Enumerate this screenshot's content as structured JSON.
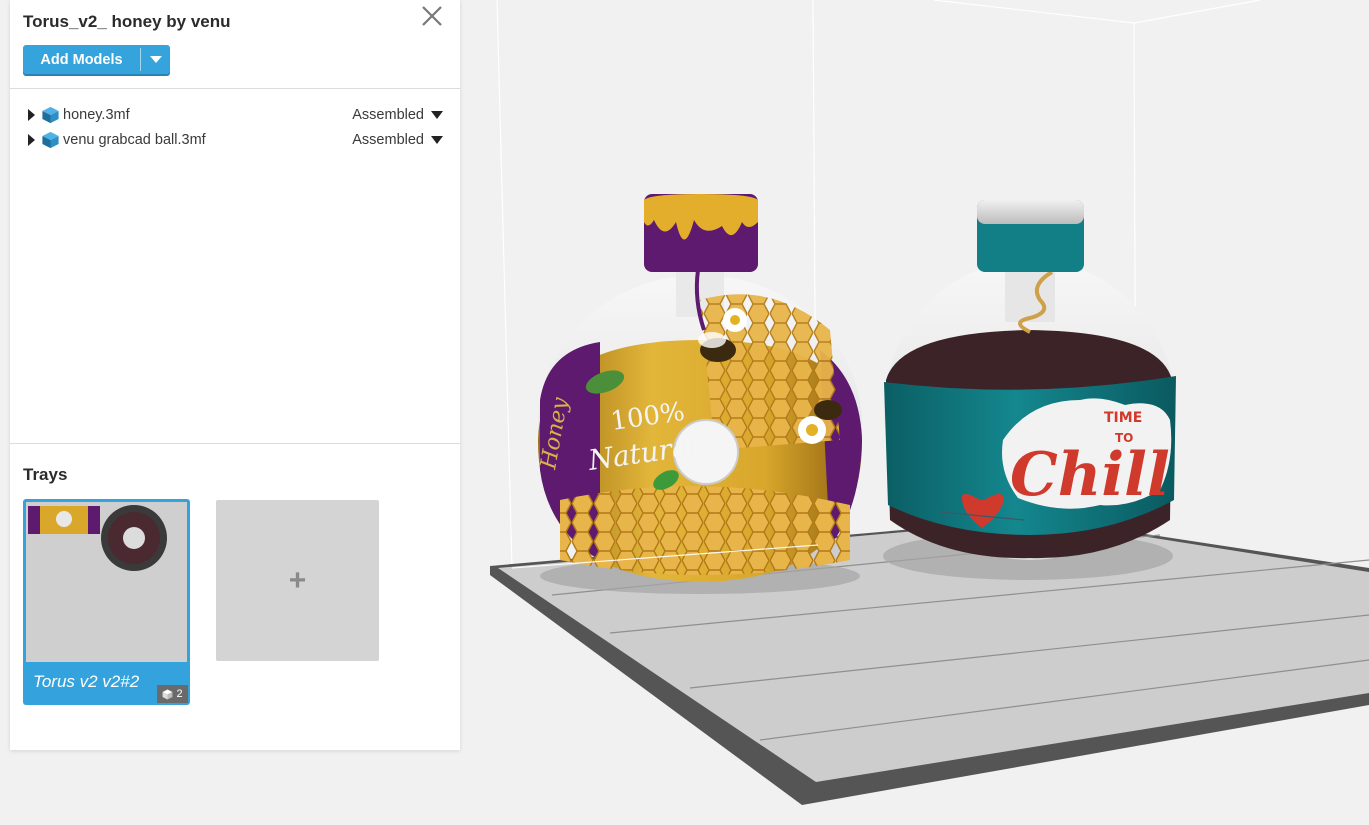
{
  "project": {
    "title": "Torus_v2_ honey by venu"
  },
  "toolbar": {
    "add_models_label": "Add Models"
  },
  "models": [
    {
      "name": "honey.3mf",
      "mode": "Assembled"
    },
    {
      "name": "venu grabcad ball.3mf",
      "mode": "Assembled"
    }
  ],
  "trays": {
    "title": "Trays",
    "items": [
      {
        "label": "Torus v2 v2#2",
        "model_count": "2"
      }
    ],
    "add_label": "+"
  },
  "scene": {
    "left_object": {
      "label_big": "100%",
      "label_small": "Natural",
      "side_text": "Honey"
    },
    "right_object": {
      "label_top": "TIME",
      "label_to": "TO",
      "label_main": "Chill"
    }
  },
  "colors": {
    "accent": "#35a4dd",
    "panel_bg": "#ffffff",
    "viewport_bg": "#f1f1f1",
    "bed": "#cfcfcf",
    "teal": "#127f86",
    "honey": "#d9a82a",
    "purple": "#5e1a6e"
  },
  "icons": {
    "close": "close-icon",
    "model": "cube-icon",
    "expand": "expand-arrow-icon",
    "dropdown": "chevron-down-icon",
    "add": "plus-icon"
  }
}
